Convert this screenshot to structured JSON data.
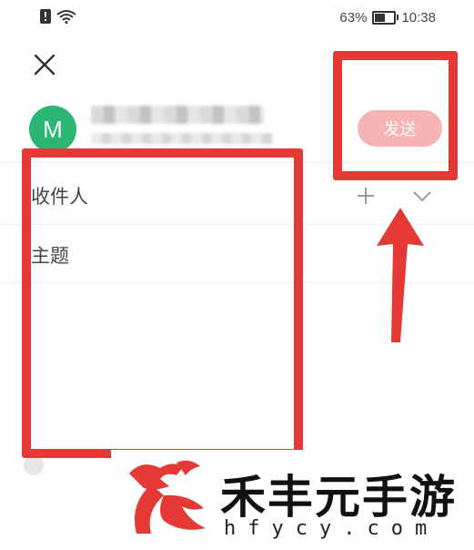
{
  "status_bar": {
    "battery_percent_label": "63%",
    "battery_level": 0.63,
    "time": "10:38",
    "icons": [
      "alert-icon",
      "wifi-icon",
      "battery-icon"
    ]
  },
  "header": {
    "close_icon": "close-icon",
    "send_label": "发送"
  },
  "sender": {
    "avatar_letter": "M",
    "avatar_color": "#2bb673"
  },
  "fields": {
    "recipient_label": "收件人",
    "subject_label": "主题",
    "icons": [
      "plus-icon",
      "chevron-down-icon"
    ]
  },
  "colors": {
    "send_button": "#f6b3b3",
    "annotation_red": "#e53935"
  },
  "watermark": {
    "brand_name": "禾丰元手游",
    "domain": "hfycy.com"
  }
}
